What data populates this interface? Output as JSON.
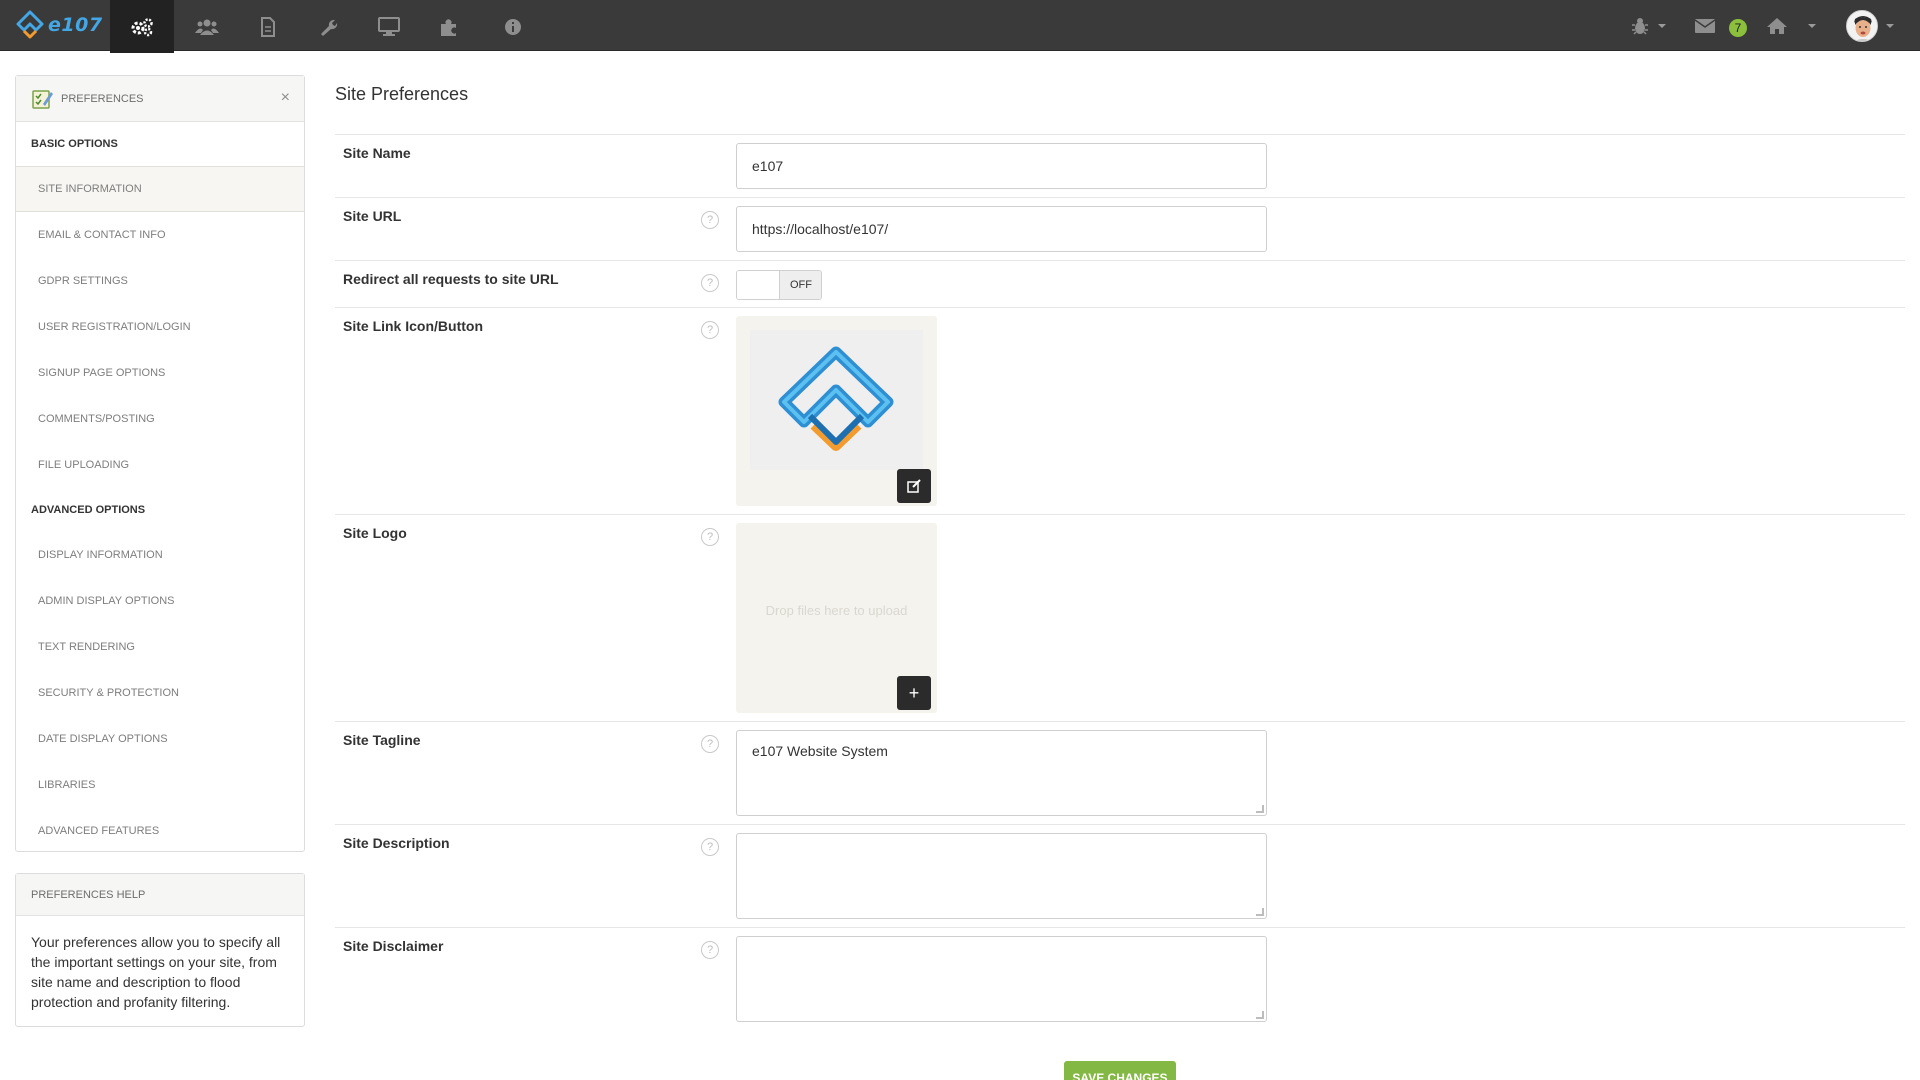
{
  "app": {
    "brand": "e107"
  },
  "topnav": {
    "items": [
      {
        "icon": "cogs-icon",
        "active": true
      },
      {
        "icon": "users-icon",
        "active": false
      },
      {
        "icon": "file-icon",
        "active": false
      },
      {
        "icon": "wrench-icon",
        "active": false
      },
      {
        "icon": "monitor-icon",
        "active": false
      },
      {
        "icon": "puzzle-icon",
        "active": false
      },
      {
        "icon": "info-icon",
        "active": false
      }
    ],
    "right": {
      "debug_icon": "bug-icon",
      "mail_icon": "envelope-icon",
      "mail_count": "7",
      "home_icon": "home-icon",
      "avatar_icon": "user-avatar"
    }
  },
  "sidebar": {
    "title": "Preferences",
    "close_label": "×",
    "sections": [
      {
        "heading": "Basic Options",
        "items": [
          {
            "label": "Site Information",
            "active": true
          },
          {
            "label": "Email & Contact Info",
            "active": false
          },
          {
            "label": "GDPR Settings",
            "active": false
          },
          {
            "label": "User Registration/Login",
            "active": false
          },
          {
            "label": "Signup Page Options",
            "active": false
          },
          {
            "label": "Comments/Posting",
            "active": false
          },
          {
            "label": "File Uploading",
            "active": false
          }
        ]
      },
      {
        "heading": "Advanced Options",
        "items": [
          {
            "label": "Display Information",
            "active": false
          },
          {
            "label": "Admin Display Options",
            "active": false
          },
          {
            "label": "Text Rendering",
            "active": false
          },
          {
            "label": "Security & Protection",
            "active": false
          },
          {
            "label": "Date Display Options",
            "active": false
          },
          {
            "label": "Libraries",
            "active": false
          },
          {
            "label": "Advanced Features",
            "active": false
          }
        ]
      }
    ]
  },
  "help_panel": {
    "title": "Preferences Help",
    "text": "Your preferences allow you to specify all the important settings on your site, from site name and description to flood protection and profanity filtering."
  },
  "main": {
    "title": "Site Preferences",
    "fields": {
      "site_name": {
        "label": "Site Name",
        "value": "e107"
      },
      "site_url": {
        "label": "Site URL",
        "value": "https://localhost/e107/"
      },
      "redirect": {
        "label": "Redirect all requests to site URL",
        "toggle_label": "OFF"
      },
      "site_button": {
        "label": "Site Link Icon/Button"
      },
      "site_logo": {
        "label": "Site Logo",
        "drop_text": "Drop files here to upload"
      },
      "site_tagline": {
        "label": "Site Tagline",
        "value": "e107 Website System"
      },
      "site_description": {
        "label": "Site Description",
        "value": ""
      },
      "site_disclaimer": {
        "label": "Site Disclaimer",
        "value": ""
      }
    },
    "help_glyph": "?",
    "save_label": "Save Changes"
  },
  "colors": {
    "navbar": "#3a3a3a",
    "accent_blue": "#43a7e5",
    "accent_orange": "#f29b2e",
    "badge_green": "#8bbf3c",
    "save_green": "#84b844"
  }
}
